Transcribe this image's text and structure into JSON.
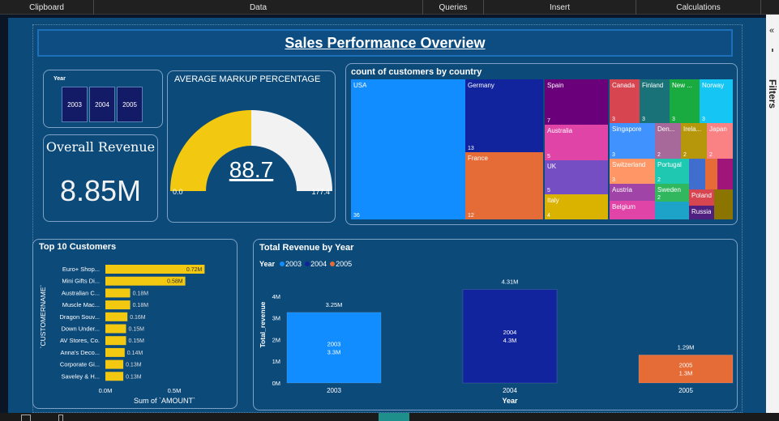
{
  "ribbon": {
    "groups": [
      {
        "label": "Clipboard",
        "width": 116
      },
      {
        "label": "Data",
        "width": 406
      },
      {
        "label": "Queries",
        "width": 75
      },
      {
        "label": "Insert",
        "width": 188
      },
      {
        "label": "Calculations",
        "width": 154
      }
    ]
  },
  "filters": {
    "label": "Filters",
    "collapse": "«"
  },
  "report": {
    "title": "Sales Performance Overview",
    "year_slicer": {
      "header": "Year",
      "options": [
        "2003",
        "2004",
        "2005"
      ]
    },
    "revenue_card": {
      "header": "Overall Revenue",
      "value": "8.85M"
    },
    "gauge": {
      "header": "AVERAGE MARKUP PERCENTAGE",
      "value": 88.7,
      "value_label": "88.7",
      "min": 0,
      "max": 177.4,
      "min_label": "0.0",
      "max_label": "177.4",
      "fill_color": "#f2c811",
      "track_color": "#f2f2f2"
    }
  },
  "chart_data": [
    {
      "type": "treemap",
      "title": "count of customers by country",
      "items": [
        {
          "label": "USA",
          "value": 36,
          "value_label": "36",
          "color": "#118dff"
        },
        {
          "label": "Germany",
          "value": 13,
          "value_label": "13",
          "color": "#12239e"
        },
        {
          "label": "France",
          "value": 12,
          "value_label": "12",
          "color": "#e66c37"
        },
        {
          "label": "Spain",
          "value": 7,
          "value_label": "7",
          "color": "#6b007b"
        },
        {
          "label": "Australia",
          "value": 5,
          "value_label": "5",
          "color": "#e044a7"
        },
        {
          "label": "UK",
          "value": 5,
          "value_label": "5",
          "color": "#744ec2"
        },
        {
          "label": "Italy",
          "value": 4,
          "value_label": "4",
          "color": "#d9b300"
        },
        {
          "label": "Canada",
          "value": 3,
          "value_label": "3",
          "color": "#d64550"
        },
        {
          "label": "Finland",
          "value": 3,
          "value_label": "3",
          "color": "#197278"
        },
        {
          "label": "New ...",
          "value": 3,
          "value_label": "3",
          "color": "#1aab40"
        },
        {
          "label": "Norway",
          "value": 3,
          "value_label": "3",
          "color": "#15c6f4"
        },
        {
          "label": "Singapore",
          "value": 3,
          "value_label": "3",
          "color": "#4092ff"
        },
        {
          "label": "Den...",
          "value": 2,
          "value_label": "2",
          "color": "#a66999"
        },
        {
          "label": "Irela...",
          "value": 2,
          "value_label": "2",
          "color": "#b6960b"
        },
        {
          "label": "Japan",
          "value": 2,
          "value_label": "2",
          "color": "#fa8184"
        },
        {
          "label": "Switzerland",
          "value": 3,
          "value_label": "3",
          "color": "#fe9666"
        },
        {
          "label": "Portugal",
          "value": 2,
          "value_label": "2",
          "color": "#1fc8b0"
        },
        {
          "label": "Austria",
          "value": 2,
          "value_label": "",
          "color": "#a044a7"
        },
        {
          "label": "Sweden",
          "value": 2,
          "value_label": "2",
          "color": "#31b85f"
        },
        {
          "label": "Belgium",
          "value": 2,
          "value_label": "",
          "color": "#e044a7"
        },
        {
          "label": "Poland",
          "value": 2,
          "value_label": "",
          "color": "#d64550"
        },
        {
          "label": "Russia",
          "value": 1,
          "value_label": "",
          "color": "#502080"
        },
        {
          "label": "",
          "value": 1,
          "value_label": "",
          "color": "#3f6ecf"
        },
        {
          "label": "",
          "value": 1,
          "value_label": "",
          "color": "#e66c37"
        },
        {
          "label": "",
          "value": 1,
          "value_label": "",
          "color": "#a0157a"
        },
        {
          "label": "",
          "value": 1,
          "value_label": "",
          "color": "#8b7500"
        },
        {
          "label": "",
          "value": 1,
          "value_label": "",
          "color": "#1da3c7"
        }
      ]
    },
    {
      "type": "bar",
      "orientation": "horizontal",
      "title": "Top 10 Customers",
      "xlabel": "Sum of `AMOUNT`",
      "ylabel": "`CUSTOMERNAME`",
      "xlim": [
        0,
        0.8
      ],
      "xticks": [
        {
          "value": 0,
          "label": "0.0M"
        },
        {
          "value": 0.5,
          "label": "0.5M"
        }
      ],
      "color": "#f2c811",
      "categories": [
        "Euro+ Shop...",
        "Mini Gifts Di...",
        "Australian C...",
        "Muscle Mac...",
        "Dragon Souv...",
        "Down Under...",
        "AV Stores, Co.",
        "Anna's Deco...",
        "Corporate Gi...",
        "Saveley & H..."
      ],
      "values": [
        0.72,
        0.58,
        0.18,
        0.18,
        0.16,
        0.15,
        0.15,
        0.14,
        0.13,
        0.13
      ],
      "value_labels": [
        "0.72M",
        "0.58M",
        "0.18M",
        "0.18M",
        "0.16M",
        "0.15M",
        "0.15M",
        "0.14M",
        "0.13M",
        "0.13M"
      ]
    },
    {
      "type": "bar",
      "title": "Total Revenue by Year",
      "xlabel": "Year",
      "ylabel": "Total_revenue",
      "legend_title": "Year",
      "ylim": [
        0,
        4.5
      ],
      "yticks": [
        {
          "value": 0,
          "label": "0M"
        },
        {
          "value": 1,
          "label": "1M"
        },
        {
          "value": 2,
          "label": "2M"
        },
        {
          "value": 3,
          "label": "3M"
        },
        {
          "value": 4,
          "label": "4M"
        }
      ],
      "categories": [
        "2003",
        "2004",
        "2005"
      ],
      "series": [
        {
          "name": "2003",
          "color": "#118dff",
          "values": [
            3.25
          ],
          "top_label": "3.25M",
          "inner": [
            "2003",
            "3.3M"
          ]
        },
        {
          "name": "2004",
          "color": "#12239e",
          "values": [
            4.31
          ],
          "top_label": "4.31M",
          "inner": [
            "2004",
            "4.3M"
          ]
        },
        {
          "name": "2005",
          "color": "#e66c37",
          "values": [
            1.29
          ],
          "top_label": "1.29M",
          "inner": [
            "2005",
            "1.3M"
          ]
        }
      ]
    }
  ]
}
